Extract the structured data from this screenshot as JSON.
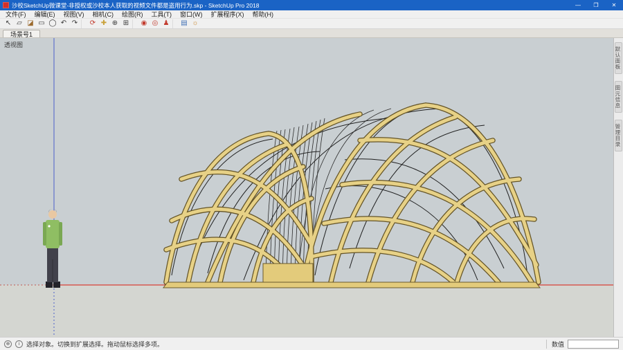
{
  "window": {
    "title": "沙校SketchUp微课堂-非授权或沙校本人获取的视频文件都是盗用行为.skp - SketchUp Pro 2018",
    "minimize_glyph": "—",
    "maximize_glyph": "❐",
    "close_glyph": "✕"
  },
  "menu_bar": {
    "items": [
      "文件(F)",
      "编辑(E)",
      "视图(V)",
      "相机(C)",
      "绘图(R)",
      "工具(T)",
      "窗口(W)",
      "扩展程序(X)",
      "帮助(H)"
    ]
  },
  "toolbar": {
    "icons": [
      {
        "name": "select-tool",
        "glyph": "↖",
        "color": "#3a3a3a"
      },
      {
        "name": "eraser-tool",
        "glyph": "▱",
        "color": "#3a3a3a"
      },
      {
        "name": "paint-bucket-tool",
        "glyph": "◪",
        "color": "#9c6b2f"
      },
      {
        "name": "rectangle-tool",
        "glyph": "▭",
        "color": "#3a3a3a"
      },
      {
        "name": "circle-tool",
        "glyph": "◯",
        "color": "#3a3a3a"
      },
      {
        "name": "undo-button",
        "glyph": "↶",
        "color": "#3a3a3a"
      },
      {
        "name": "redo-button",
        "glyph": "↷",
        "color": "#3a3a3a"
      },
      {
        "name": "orbit-tool",
        "glyph": "⟳",
        "color": "#c23b2e"
      },
      {
        "name": "pan-tool",
        "glyph": "✚",
        "color": "#c9a13a"
      },
      {
        "name": "zoom-tool",
        "glyph": "⊕",
        "color": "#3a3a3a"
      },
      {
        "name": "zoom-extents-tool",
        "glyph": "⊞",
        "color": "#3a3a3a"
      },
      {
        "name": "position-camera-tool",
        "glyph": "◉",
        "color": "#c23b2e"
      },
      {
        "name": "look-around-tool",
        "glyph": "◎",
        "color": "#c23b2e"
      },
      {
        "name": "walk-tool",
        "glyph": "♟",
        "color": "#c23b2e"
      },
      {
        "name": "styles-tool",
        "glyph": "▤",
        "color": "#3f6fb5"
      },
      {
        "name": "shadows-tool",
        "glyph": "☼",
        "color": "#c9872f"
      }
    ]
  },
  "scene_bar": {
    "tabs": [
      "场景号1"
    ]
  },
  "viewport": {
    "camera_label": "透视图",
    "colors": {
      "sky": "#c9cfd2",
      "ground": "#d4d6d1",
      "axis_red": "#d84036",
      "axis_blue": "#4a5fc9",
      "model_gold": "#e7d186",
      "model_gold_dark": "#645427"
    }
  },
  "side_tray": {
    "tabs": [
      "默认面板",
      "图元信息",
      "管理目录"
    ]
  },
  "status_bar": {
    "icons": [
      {
        "name": "geolocation-icon",
        "glyph": "⊕"
      },
      {
        "name": "credits-icon",
        "glyph": "i"
      }
    ],
    "hint": "选择对象。切换到扩展选择。拖动鼠标选择多项。",
    "measurement_label": "数值",
    "measurement_value": ""
  }
}
